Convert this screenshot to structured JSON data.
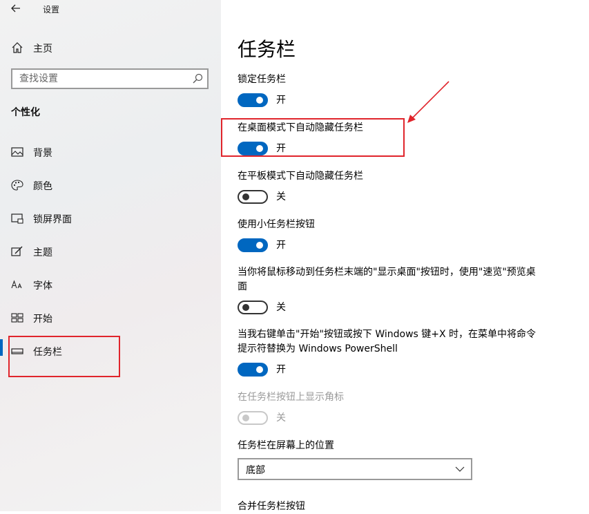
{
  "window": {
    "title": "设置"
  },
  "sidebar": {
    "home_label": "主页",
    "search_placeholder": "查找设置",
    "section_heading": "个性化",
    "items": [
      {
        "label": "背景",
        "icon": "image-icon"
      },
      {
        "label": "颜色",
        "icon": "palette-icon"
      },
      {
        "label": "锁屏界面",
        "icon": "lock-screen-icon"
      },
      {
        "label": "主题",
        "icon": "brush-icon"
      },
      {
        "label": "字体",
        "icon": "font-icon"
      },
      {
        "label": "开始",
        "icon": "start-menu-icon"
      },
      {
        "label": "任务栏",
        "icon": "taskbar-icon",
        "active": true
      }
    ]
  },
  "main": {
    "title": "任务栏",
    "settings": [
      {
        "label": "锁定任务栏",
        "state": "开",
        "on": true
      },
      {
        "label": "在桌面模式下自动隐藏任务栏",
        "state": "开",
        "on": true
      },
      {
        "label": "在平板模式下自动隐藏任务栏",
        "state": "关",
        "on": false
      },
      {
        "label": "使用小任务栏按钮",
        "state": "开",
        "on": true
      },
      {
        "label": "当你将鼠标移动到任务栏末端的\"显示桌面\"按钮时，使用\"速览\"预览桌面",
        "state": "关",
        "on": false
      },
      {
        "label": "当我右键单击\"开始\"按钮或按下 Windows 键+X 时，在菜单中将命令提示符替换为 Windows PowerShell",
        "state": "开",
        "on": true
      },
      {
        "label": "在任务栏按钮上显示角标",
        "state": "关",
        "on": false,
        "disabled": true
      }
    ],
    "position_label": "任务栏在屏幕上的位置",
    "position_value": "底部",
    "combine_label": "合并任务栏按钮"
  },
  "colors": {
    "accent": "#0067c0",
    "annotation": "#e0242b"
  }
}
